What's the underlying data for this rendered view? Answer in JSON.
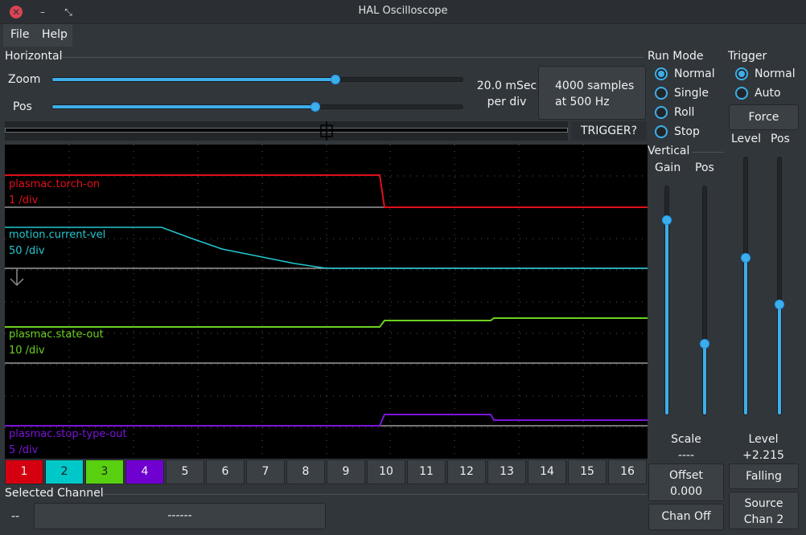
{
  "window": {
    "title": "HAL Oscilloscope",
    "close_glyph": "✕",
    "minimize_glyph": "–",
    "restore_glyph": "⤡"
  },
  "menu": {
    "file": "File",
    "help": "Help"
  },
  "horizontal": {
    "title": "Horizontal",
    "zoom_label": "Zoom",
    "pos_label": "Pos",
    "zoom_level": 0.69,
    "pos_level": 0.64,
    "rate_line1": "20.0 mSec",
    "rate_line2": "per div",
    "samples_line1": "4000 samples",
    "samples_line2": "at 500 Hz",
    "trigger_status": "TRIGGER?"
  },
  "run_mode": {
    "title": "Run Mode",
    "options": [
      "Normal",
      "Single",
      "Roll",
      "Stop"
    ],
    "selected": "Normal"
  },
  "trigger": {
    "title": "Trigger",
    "options": [
      "Normal",
      "Auto"
    ],
    "selected": "Normal",
    "force_label": "Force",
    "level_label": "Level",
    "pos_label": "Pos",
    "level_value_title": "Level",
    "level_value": "+2.215",
    "edge_button": "Falling",
    "source_line1": "Source",
    "source_line2": "Chan  2",
    "level_slider": 0.61,
    "pos_slider": 0.43
  },
  "vertical": {
    "title": "Vertical",
    "gain_label": "Gain",
    "pos_label": "Pos",
    "scale_title": "Scale",
    "scale_value": "----",
    "offset_title": "Offset",
    "offset_value": "0.000",
    "chan_off_button": "Chan Off",
    "gain_slider": 0.85,
    "pos_slider": 0.31
  },
  "traces": [
    {
      "name": "plasmac.torch-on",
      "scale": "1 /div",
      "color": "#e0101a"
    },
    {
      "name": "motion.current-vel",
      "scale": "50 /div",
      "color": "#22c8d0"
    },
    {
      "name": "plasmac.state-out",
      "scale": "10 /div",
      "color": "#6cd020"
    },
    {
      "name": "plasmac.stop-type-out",
      "scale": "5 /div",
      "color": "#7a14d8"
    }
  ],
  "channels": {
    "buttons": [
      "1",
      "2",
      "3",
      "4",
      "5",
      "6",
      "7",
      "8",
      "9",
      "10",
      "11",
      "12",
      "13",
      "14",
      "15",
      "16"
    ],
    "colors": [
      "#d40010",
      "#00c8c8",
      "#58d010",
      "#7000d0"
    ]
  },
  "selected_channel": {
    "title": "Selected Channel",
    "number": "--",
    "name": "------"
  },
  "icons": {
    "cursor_marker": "arrow-down-icon",
    "trigger_marker": "crosshair-icon"
  }
}
